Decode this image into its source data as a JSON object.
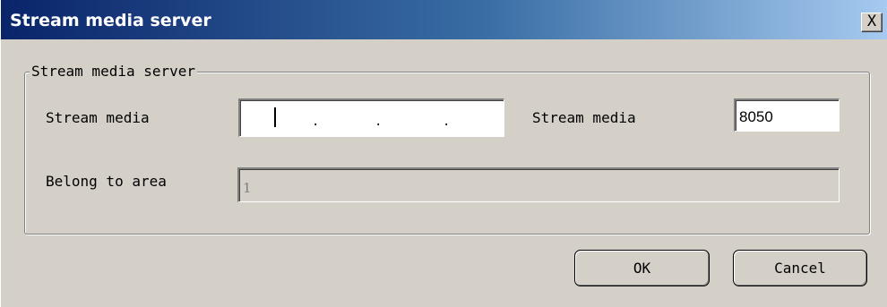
{
  "window": {
    "title": "Stream media server",
    "close_label": "X"
  },
  "group": {
    "legend": "Stream media server"
  },
  "fields": {
    "ip_label": "Stream media",
    "ip_dots": [
      ".",
      ".",
      "."
    ],
    "port_label": "Stream media",
    "port_value": "8050",
    "area_label": "Belong to area",
    "area_value": "1"
  },
  "buttons": {
    "ok": "OK",
    "cancel": "Cancel"
  }
}
